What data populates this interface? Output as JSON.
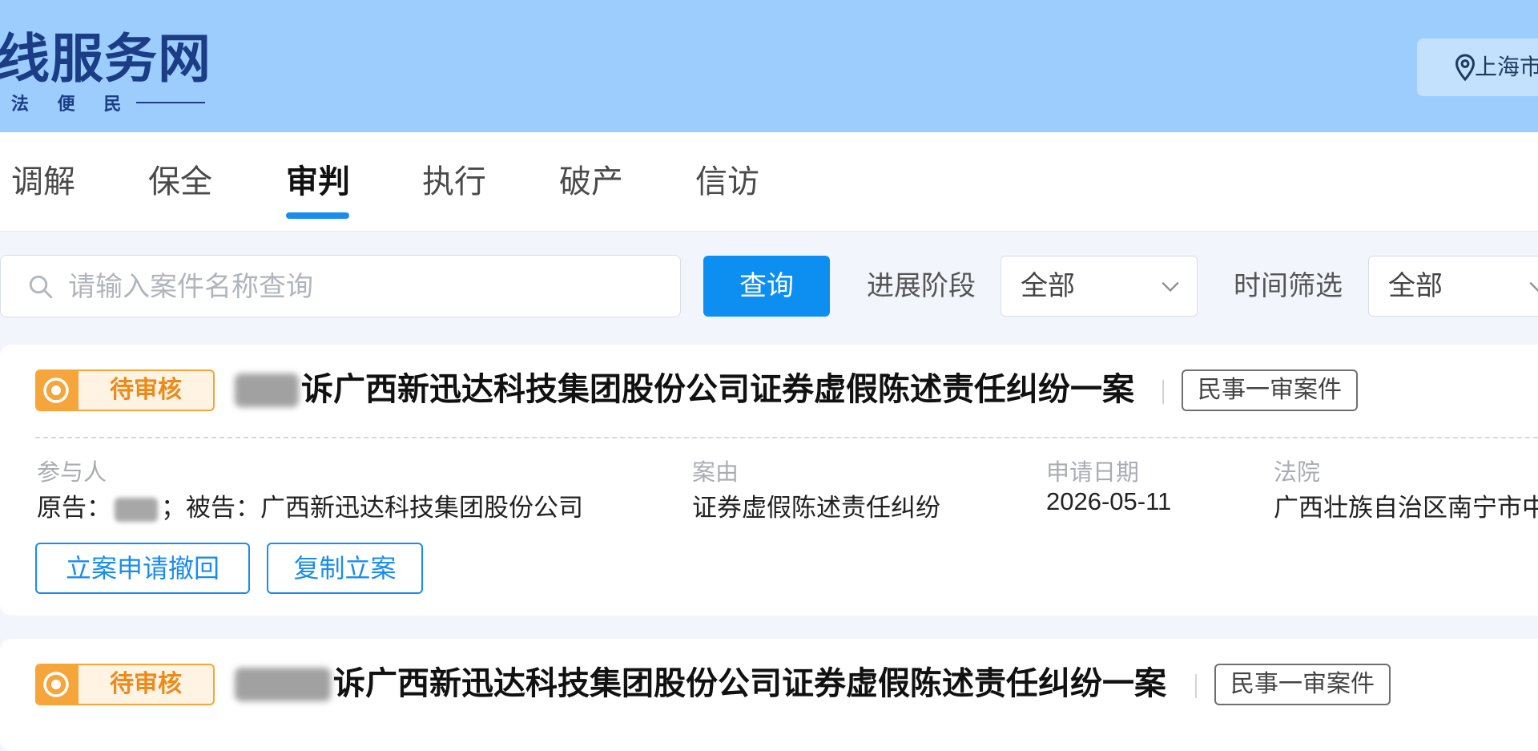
{
  "header": {
    "title": "线服务网",
    "subtitle": "法 便 民",
    "location": "上海市"
  },
  "tabs": [
    {
      "label": "调解",
      "active": false
    },
    {
      "label": "保全",
      "active": false
    },
    {
      "label": "审判",
      "active": true
    },
    {
      "label": "执行",
      "active": false
    },
    {
      "label": "破产",
      "active": false
    },
    {
      "label": "信访",
      "active": false
    }
  ],
  "filters": {
    "search_placeholder": "请输入案件名称查询",
    "search_value": "",
    "query_label": "查询",
    "stage_label": "进展阶段",
    "stage_value": "全部",
    "time_label": "时间筛选",
    "time_value": "全部"
  },
  "cases": [
    {
      "status": "待审核",
      "title": "诉广西新迅达科技集团股份公司证券虚假陈述责任纠纷一案",
      "type": "民事一审案件",
      "participants_label": "参与人",
      "plaintiff_prefix": "原告：",
      "defendant_part": "；被告：广西新迅达科技集团股份公司",
      "cause_label": "案由",
      "cause": "证券虚假陈述责任纠纷",
      "date_label": "申请日期",
      "date": "2026-05-11",
      "court_label": "法院",
      "court": "广西壮族自治区南宁市中",
      "actions": [
        "立案申请撤回",
        "复制立案"
      ]
    },
    {
      "status": "待审核",
      "title": "诉广西新迅达科技集团股份公司证券虚假陈述责任纠纷一案",
      "type": "民事一审案件"
    }
  ],
  "colors": {
    "header_bg": "#9dcdfd",
    "accent": "#1a8cf0",
    "pending": "#f6a53a"
  }
}
